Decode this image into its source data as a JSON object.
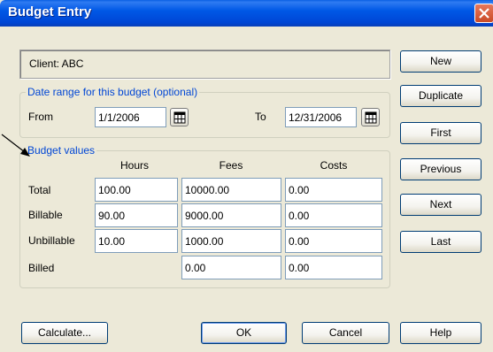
{
  "window": {
    "title": "Budget Entry"
  },
  "client": {
    "text": "Client: ABC"
  },
  "date_range": {
    "legend": "Date range for this budget (optional)",
    "from_label": "From",
    "from_value": "1/1/2006",
    "to_label": "To",
    "to_value": "12/31/2006"
  },
  "budget": {
    "legend": "Budget values",
    "columns": [
      "Hours",
      "Fees",
      "Costs"
    ],
    "rows": [
      {
        "label": "Total",
        "hours": "100.00",
        "fees": "10000.00",
        "costs": "0.00"
      },
      {
        "label": "Billable",
        "hours": "90.00",
        "fees": "9000.00",
        "costs": "0.00"
      },
      {
        "label": "Unbillable",
        "hours": "10.00",
        "fees": "1000.00",
        "costs": "0.00"
      },
      {
        "label": "Billed",
        "fees": "0.00",
        "costs": "0.00"
      }
    ]
  },
  "side_buttons": {
    "new": "New",
    "duplicate": "Duplicate",
    "first": "First",
    "previous": "Previous",
    "next": "Next",
    "last": "Last"
  },
  "bottom_buttons": {
    "calculate": "Calculate...",
    "ok": "OK",
    "cancel": "Cancel",
    "help": "Help"
  },
  "icons": {
    "close": "close-icon",
    "calendar": "calendar-icon",
    "pointer": "callout-arrow"
  }
}
